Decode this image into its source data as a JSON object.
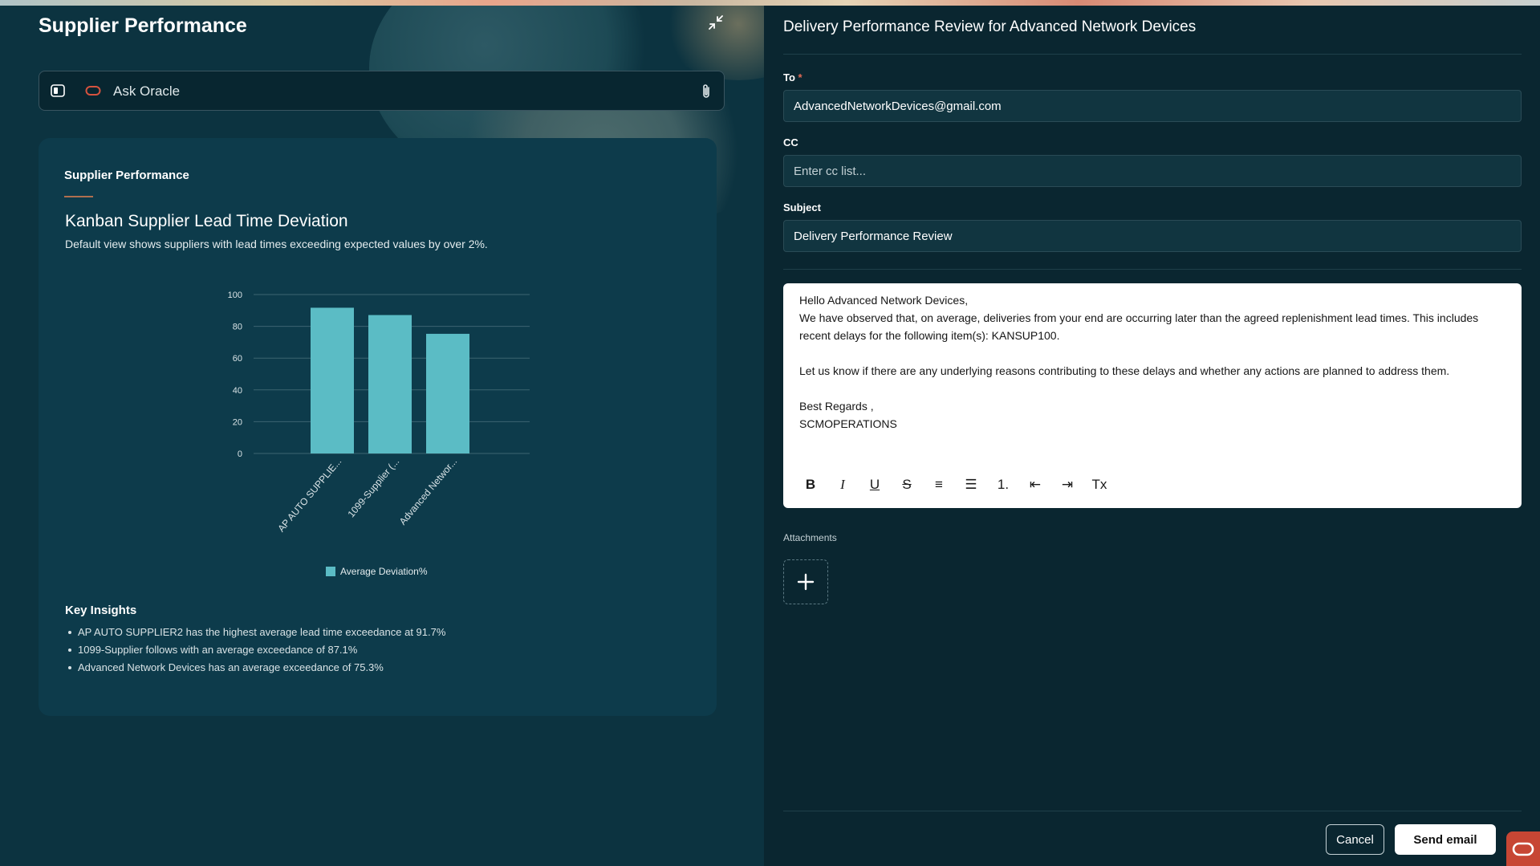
{
  "left_panel": {
    "app_title": "Supplier Performance",
    "ask_bar": {
      "placeholder": "Ask Oracle"
    },
    "card": {
      "heading": "Supplier Performance",
      "chart_title": "Kanban Supplier Lead Time Deviation",
      "chart_subtitle": "Default view shows suppliers with lead times exceeding expected values by over 2%.",
      "insights_title": "Key Insights",
      "insights": [
        "AP AUTO SUPPLIER2 has the highest average lead time exceedance at 91.7%",
        "1099-Supplier follows with an average exceedance of 87.1%",
        "Advanced Network Devices has an average exceedance of 75.3%"
      ]
    }
  },
  "chart_data": {
    "type": "bar",
    "categories": [
      "AP AUTO SUPPLIE...",
      "1099-Supplier (...",
      "Advanced Networ..."
    ],
    "series": [
      {
        "name": "Average Deviation%",
        "values": [
          91.7,
          87.1,
          75.3
        ],
        "color": "#5bbcc5"
      }
    ],
    "ylim": [
      0,
      100
    ],
    "yticks": [
      0,
      20,
      40,
      60,
      80,
      100
    ],
    "legend": "bottom",
    "grid": true
  },
  "email": {
    "title": "Delivery Performance Review for Advanced Network Devices",
    "to_label": "To",
    "required_mark": "*",
    "to_value": "AdvancedNetworkDevices@gmail.com",
    "cc_label": "CC",
    "cc_placeholder": "Enter cc list...",
    "subject_label": "Subject",
    "subject_value": "Delivery Performance Review",
    "body": [
      "Hello Advanced Network Devices,",
      "We have observed that, on average, deliveries from your end are occurring later than the agreed replenishment lead times. This includes recent delays for the following item(s): KANSUP100.",
      "",
      "Let us know if there are any underlying reasons contributing to these delays and whether any actions are planned to address them.",
      "",
      "Best Regards ,",
      "SCMOPERATIONS"
    ],
    "toolbar": {
      "bold": "B",
      "italic": "I",
      "underline": "U",
      "strike": "S",
      "align": "≡",
      "bullets": "☰",
      "numbered": "1.",
      "outdent": "⇤",
      "indent": "⇥",
      "clear": "Tx"
    },
    "attachments_label": "Attachments",
    "cancel_label": "Cancel",
    "send_label": "Send email"
  },
  "colors": {
    "accent_bar": "#5bbcc5",
    "oracle_red": "#c74634"
  }
}
